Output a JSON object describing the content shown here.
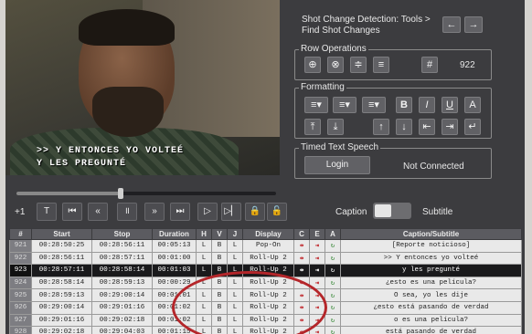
{
  "video": {
    "caption_line1": ">> Y ENTONCES YO VOLTEÉ",
    "caption_line2": "Y LES PREGUNTÉ"
  },
  "shot_change": {
    "text_line1": "Shot Change Detection: Tools >",
    "text_line2": "Find Shot Changes",
    "prev_icon": "arrow-left-icon",
    "next_icon": "arrow-right-icon"
  },
  "row_operations": {
    "title": "Row Operations",
    "buttons": [
      "insert-row-icon",
      "delete-row-icon",
      "split-row-icon",
      "merge-row-icon",
      "hash-icon"
    ],
    "count": "922"
  },
  "formatting": {
    "title": "Formatting",
    "bold": "B",
    "italic": "I",
    "underline": "U",
    "color": "A"
  },
  "tts": {
    "title": "Timed Text Speech",
    "login_label": "Login",
    "status": "Not Connected"
  },
  "transport": {
    "offset_label": "+1",
    "seek_fraction": 0.4
  },
  "mode": {
    "caption_label": "Caption",
    "subtitle_label": "Subtitle"
  },
  "table": {
    "columns": [
      "#",
      "Start",
      "Stop",
      "Duration",
      "H",
      "V",
      "J",
      "Display",
      "C",
      "E",
      "A",
      "Caption/Subtitle"
    ],
    "rows": [
      {
        "n": "921",
        "start": "00:28:50:25",
        "stop": "00:28:56:11",
        "dur": "00:05:13",
        "h": "L",
        "v": "B",
        "j": "L",
        "display": "Pop-On",
        "text": "[Reporte noticioso]"
      },
      {
        "n": "922",
        "start": "00:28:56:11",
        "stop": "00:28:57:11",
        "dur": "00:01:00",
        "h": "L",
        "v": "B",
        "j": "L",
        "display": "Roll-Up 2",
        "text": ">> Y entonces yo volteé"
      },
      {
        "n": "923",
        "start": "00:28:57:11",
        "stop": "00:28:58:14",
        "dur": "00:01:03",
        "h": "L",
        "v": "B",
        "j": "L",
        "display": "Roll-Up 2",
        "text": "y les pregunté"
      },
      {
        "n": "924",
        "start": "00:28:58:14",
        "stop": "00:28:59:13",
        "dur": "00:00:29",
        "h": "L",
        "v": "B",
        "j": "L",
        "display": "Roll-Up 2",
        "text": "¿esto es una película?"
      },
      {
        "n": "925",
        "start": "00:28:59:13",
        "stop": "00:29:00:14",
        "dur": "00:01:01",
        "h": "L",
        "v": "B",
        "j": "L",
        "display": "Roll-Up 2",
        "text": "O sea, yo les dije"
      },
      {
        "n": "926",
        "start": "00:29:00:14",
        "stop": "00:29:01:16",
        "dur": "00:01:02",
        "h": "L",
        "v": "B",
        "j": "L",
        "display": "Roll-Up 2",
        "text": "¿esto está pasando de verdad"
      },
      {
        "n": "927",
        "start": "00:29:01:16",
        "stop": "00:29:02:18",
        "dur": "00:01:02",
        "h": "L",
        "v": "B",
        "j": "L",
        "display": "Roll-Up 2",
        "text": "o es una película?"
      },
      {
        "n": "928",
        "start": "00:29:02:18",
        "stop": "00:29:04:03",
        "dur": "00:01:15",
        "h": "L",
        "v": "B",
        "j": "L",
        "display": "Roll-Up 2",
        "text": "está pasando de verdad"
      }
    ],
    "selected_index": 2
  }
}
